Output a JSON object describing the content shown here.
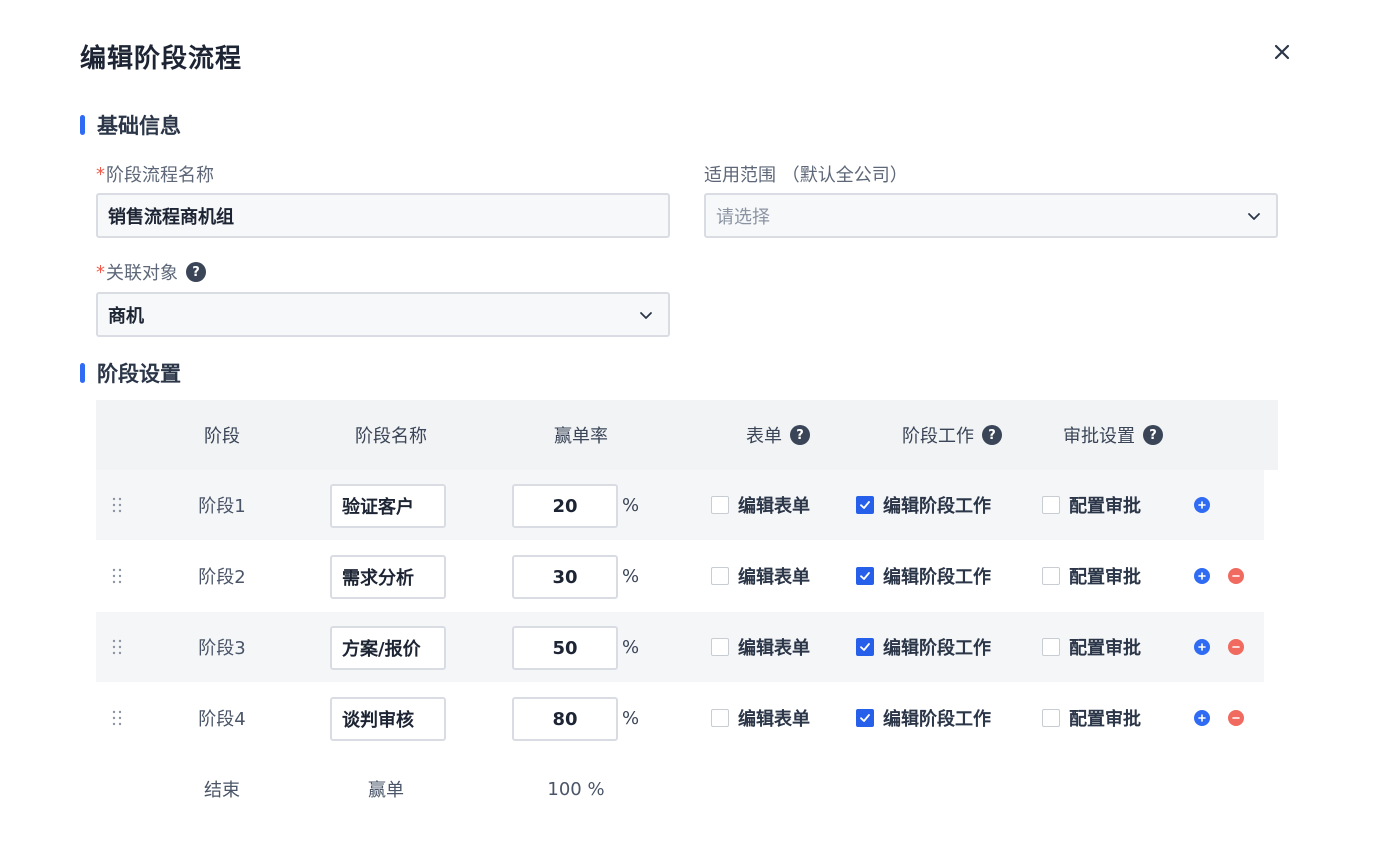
{
  "dialog": {
    "title": "编辑阶段流程"
  },
  "basic": {
    "section_title": "基础信息",
    "name_field": {
      "required_mark": "*",
      "label": "阶段流程名称",
      "value": "销售流程商机组"
    },
    "scope_field": {
      "label": "适用范围 （默认全公司）",
      "placeholder": "请选择"
    },
    "object_field": {
      "required_mark": "*",
      "label": "关联对象",
      "help": "?",
      "value": "商机"
    }
  },
  "stages": {
    "section_title": "阶段设置",
    "headers": {
      "stage": "阶段",
      "name": "阶段名称",
      "rate": "赢单率",
      "form": "表单",
      "work": "阶段工作",
      "approval": "审批设置",
      "help": "?"
    },
    "rows": [
      {
        "stage": "阶段1",
        "name": "验证客户",
        "rate": "20",
        "pct": "%",
        "form_label": "编辑表单",
        "form_checked": false,
        "work_label": "编辑阶段工作",
        "work_checked": true,
        "approval_label": "配置审批",
        "approval_checked": false
      },
      {
        "stage": "阶段2",
        "name": "需求分析",
        "rate": "30",
        "pct": "%",
        "form_label": "编辑表单",
        "form_checked": false,
        "work_label": "编辑阶段工作",
        "work_checked": true,
        "approval_label": "配置审批",
        "approval_checked": false
      },
      {
        "stage": "阶段3",
        "name": "方案/报价",
        "rate": "50",
        "pct": "%",
        "form_label": "编辑表单",
        "form_checked": false,
        "work_label": "编辑阶段工作",
        "work_checked": true,
        "approval_label": "配置审批",
        "approval_checked": false
      },
      {
        "stage": "阶段4",
        "name": "谈判审核",
        "rate": "80",
        "pct": "%",
        "form_label": "编辑表单",
        "form_checked": false,
        "work_label": "编辑阶段工作",
        "work_checked": true,
        "approval_label": "配置审批",
        "approval_checked": false
      }
    ],
    "end_row": {
      "stage": "结束",
      "name": "赢单",
      "rate": "100 %"
    }
  },
  "colors": {
    "accent": "#2f6bf3",
    "danger": "#f06a5f",
    "required": "#f25a4a"
  },
  "icons": {
    "close": "close-icon",
    "dropdown": "chevron-down-icon",
    "drag": "drag-handle-icon",
    "add": "plus-circle-icon",
    "remove": "minus-circle-icon",
    "help": "question-circle-icon",
    "check": "check-icon"
  }
}
